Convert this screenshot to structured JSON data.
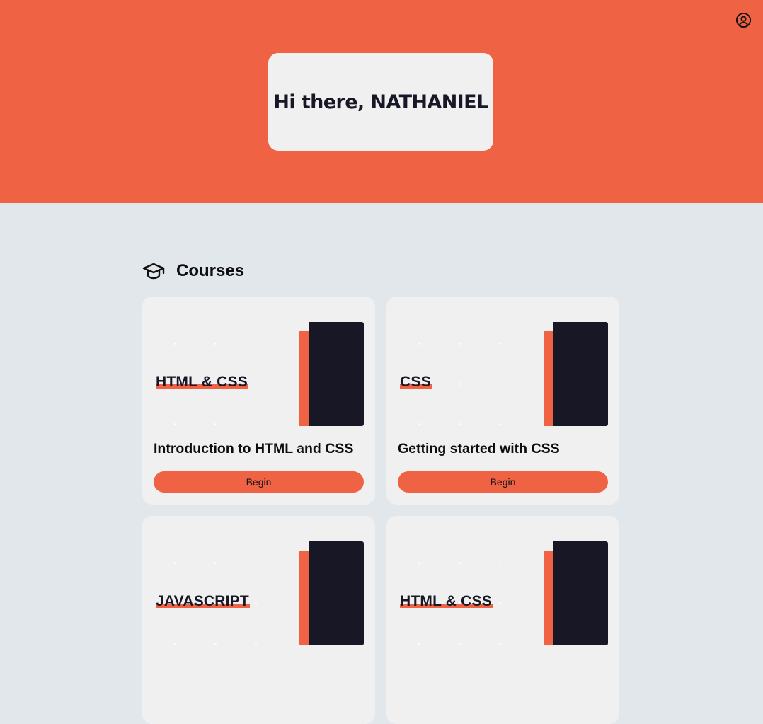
{
  "greeting": "Hi there, NATHANIEL",
  "colors": {
    "accent": "#f06244",
    "dark": "#171726",
    "card": "#f0f0f0",
    "background": "#e2e7ec"
  },
  "header": {
    "account_icon": "user-circle-icon"
  },
  "courses_section": {
    "title": "Courses",
    "icon": "graduation-cap-icon",
    "items": [
      {
        "tag": "HTML & CSS",
        "title": "Introduction to HTML and CSS",
        "button_label": "Begin"
      },
      {
        "tag": "CSS",
        "title": "Getting started with CSS",
        "button_label": "Begin"
      },
      {
        "tag": "JAVASCRIPT",
        "title": "",
        "button_label": ""
      },
      {
        "tag": "HTML & CSS",
        "title": "",
        "button_label": ""
      }
    ]
  }
}
